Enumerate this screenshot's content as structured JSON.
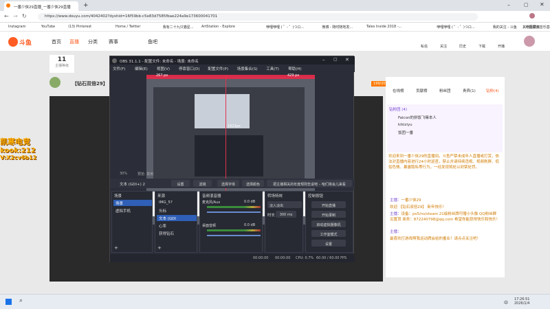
{
  "browser": {
    "tab_title": "一番少侠29直播_一番少侠29直播",
    "url": "https://www.douyu.com/4042402?dyshid=16f59bb-c5e83d7585fbae224a9e173600041701",
    "bookmarks": [
      "Instagram",
      "YouTube",
      "(13) Pinterest",
      "Home / Twitter",
      "我有二十九只猫星...",
      "ArtStation - Explore",
      "咿哩咿哩 ( ゜- ゜)つロ...",
      "微博 - 随时随地发...",
      "Tales Inside 2018 -...",
      "咿哩咿哩 ( ゜- ゜)つロ...",
      "我的关注 - 斗鱼",
      "中国原创音乐基地...",
      "",
      "其他收藏夹"
    ]
  },
  "douyu": {
    "logo": "斗鱼",
    "nav": [
      "首页",
      "直播",
      "分类",
      "赛事",
      "鱼吧"
    ],
    "header_icons": [
      "私信",
      "关注",
      "历史",
      "下载",
      "开播"
    ],
    "room_title": "【钻石双倍29】",
    "streamer": "一番少侠29",
    "level": "11",
    "level_label": "主播等级",
    "rank_badge": "199/200",
    "chat_tabs": [
      "在线榜",
      "贡献榜",
      "粉丝团",
      "贵宾(1)",
      "钻粉(4)"
    ],
    "fans_label": "钻粉团 (4)",
    "fan_names": [
      "Falcon的拼饭飞嘛本人",
      "kikiziyu",
      "饭团一番"
    ],
    "notice": "欢迎来到一番少侠29的直播间。斗鱼严禁未成年人直播或打赏，依法对直播内容进行24小时巡查，禁止并请持续违规、视频刷屏、低俗色情、暴露隐私等行为，一经发现将处以封禁处罚。",
    "chat": [
      {
        "user": "主播：",
        "text": "一番少侠29"
      },
      {
        "user": "",
        "text": "欢迎 【钻石双倍29】 新年快乐！"
      },
      {
        "user": "主播：",
        "text": "设备：ps5/ns/steam 21级粉丝牌可赠小头像 QQ粉丝群见置顶 商务：872240798@qq.com 希望你能获得快乐和快乐！"
      },
      {
        "user": "主播：",
        "text": ""
      },
      {
        "user": "",
        "text": "最喜欢打游戏啊我运动牌会给的番业！请点点关注吧！"
      }
    ],
    "watermark_line1": "凯寒电竞",
    "watermark_line2": "kook:212",
    "watermark_line3": "V:X2cv6b12"
  },
  "obs": {
    "title": "OBS 31.1.1 - 配置文件: 未命名 - 场景: 未命名",
    "menu": [
      "文件(F)",
      "编辑(E)",
      "视图(V)",
      "停靠窗口(D)",
      "配置文件(P)",
      "场景集合(S)",
      "工具(T)",
      "帮助(H)"
    ],
    "preview_label_top": "429 px",
    "preview_label_left": "267 px",
    "preview_label_mid": "1923px",
    "zoom": "30%",
    "preview_mode": "预览: 禁用",
    "source_selected": "文本 (GDI+) 2",
    "source_buttons": [
      "设置",
      "滤镜",
      "选择字体",
      "选择颜色",
      "把主播相关的年度规则告说吧 – 哈们将会儿来看"
    ],
    "docks": {
      "scenes": "场景",
      "sources": "来源",
      "mixer": "音频混音器",
      "transitions": "转场特效",
      "controls": "控制按钮"
    },
    "scenes": [
      "场景",
      "虚拟手机"
    ],
    "sources": [
      "IMG_5?",
      "头标",
      "文本 (GDI",
      "心率",
      "获得钻石"
    ],
    "mixer": [
      {
        "name": "麦克风/Aux",
        "level": "0.0 dB"
      },
      {
        "name": "桌面音频",
        "level": "0.0 dB"
      }
    ],
    "transition": {
      "type": "淡入淡出",
      "duration_label": "时长",
      "duration": "300 ms"
    },
    "controls": [
      "开始直播",
      "开始录制",
      "启动虚拟摄像机",
      "工作室模式",
      "设置"
    ],
    "status_time1": "00:00:00",
    "status_time2": "00:00:00",
    "cpu": "CPU: 0.7%",
    "fps": "60.00 / 60.00 FPS"
  },
  "taskbar": {
    "time": "17:26:51",
    "date": "2026/1/4",
    "lang": "中"
  }
}
